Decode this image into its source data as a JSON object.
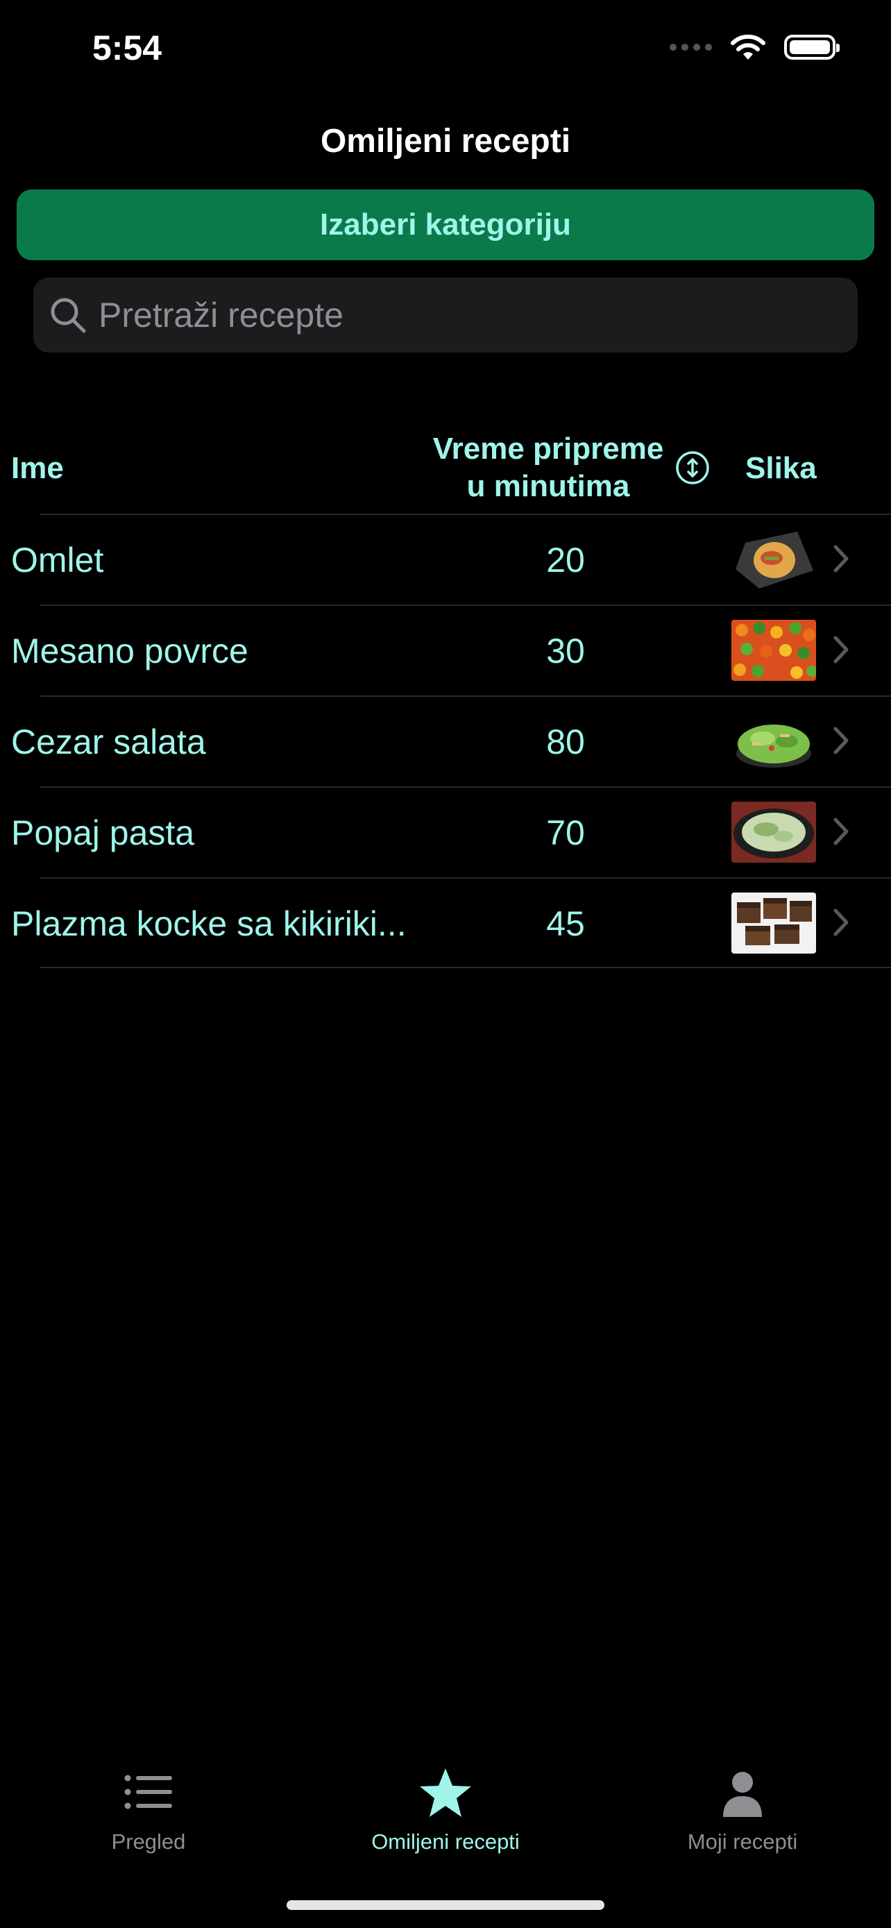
{
  "status_bar": {
    "time": "5:54"
  },
  "nav": {
    "title": "Omiljeni recepti"
  },
  "category_button": {
    "label": "Izaberi kategoriju"
  },
  "search": {
    "placeholder": "Pretraži recepte"
  },
  "table": {
    "headers": {
      "name": "Ime",
      "time_line1": "Vreme pripreme",
      "time_line2": "u minutima",
      "image": "Slika"
    },
    "rows": [
      {
        "name": "Omlet",
        "time": "20",
        "image_icon": "omelet-photo"
      },
      {
        "name": "Mesano povrce",
        "time": "30",
        "image_icon": "mixed-vegetables-photo"
      },
      {
        "name": "Cezar salata",
        "time": "80",
        "image_icon": "caesar-salad-photo"
      },
      {
        "name": "Popaj pasta",
        "time": "70",
        "image_icon": "spinach-pasta-photo"
      },
      {
        "name": "Plazma kocke sa kikiriki...",
        "time": "45",
        "image_icon": "plazma-cubes-photo"
      }
    ]
  },
  "tab_bar": {
    "tabs": [
      {
        "label": "Pregled",
        "icon": "list-icon",
        "active": false
      },
      {
        "label": "Omiljeni recepti",
        "icon": "star-icon",
        "active": true
      },
      {
        "label": "Moji recepti",
        "icon": "person-icon",
        "active": false
      }
    ]
  },
  "colors": {
    "accent": "#9ff5ea",
    "button_green": "#0b7a4b",
    "background": "#000000",
    "search_bg": "#1c1c1e"
  }
}
